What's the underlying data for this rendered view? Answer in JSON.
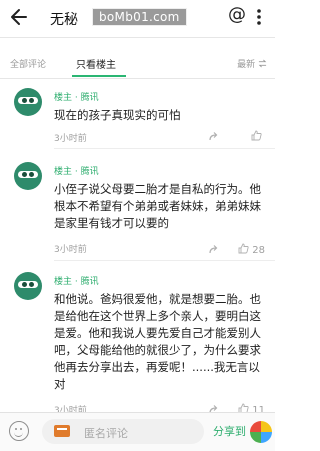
{
  "header": {
    "title": "无秘",
    "watermark": "boMb01.com",
    "at_symbol": "@"
  },
  "tabs": [
    {
      "label": "全部评论",
      "active": false
    },
    {
      "label": "只看楼主",
      "active": true
    },
    {
      "label": "最新",
      "active": false
    }
  ],
  "comments": [
    {
      "author": "楼主 · 腾讯",
      "text": "现在的孩子真现实的可怕",
      "time": "3小时前",
      "likes": ""
    },
    {
      "author": "楼主 · 腾讯",
      "text": "小侄子说父母要二胎才是自私的行为。他根本不希望有个弟弟或者妹妹，弟弟妹妹是家里有钱才可以要的",
      "time": "3小时前",
      "likes": "28"
    },
    {
      "author": "楼主 · 腾讯",
      "text": "和他说。爸妈很爱他，就是想要二胎。也是给他在这个世界上多个亲人，要明白这是爱。他和我说人要先爱自己才能爱别人吧，父母能给他的就很少了，为什么要求他再去分享出去，再爱呢！......我无言以对",
      "time": "3小时前",
      "likes": "11"
    }
  ],
  "bottom_bar": {
    "placeholder": "匿名评论",
    "share_label": "分享到"
  },
  "colors": {
    "accent_green": "#2fae6f",
    "avatar_green": "#2e8b6b",
    "card_orange": "#e07b2c"
  },
  "icons": [
    "back-arrow-icon",
    "more-vertical-icon",
    "avatar-mask-icon",
    "like-icon",
    "share-icon",
    "emoji-icon",
    "card-icon",
    "share-apps-icon"
  ]
}
